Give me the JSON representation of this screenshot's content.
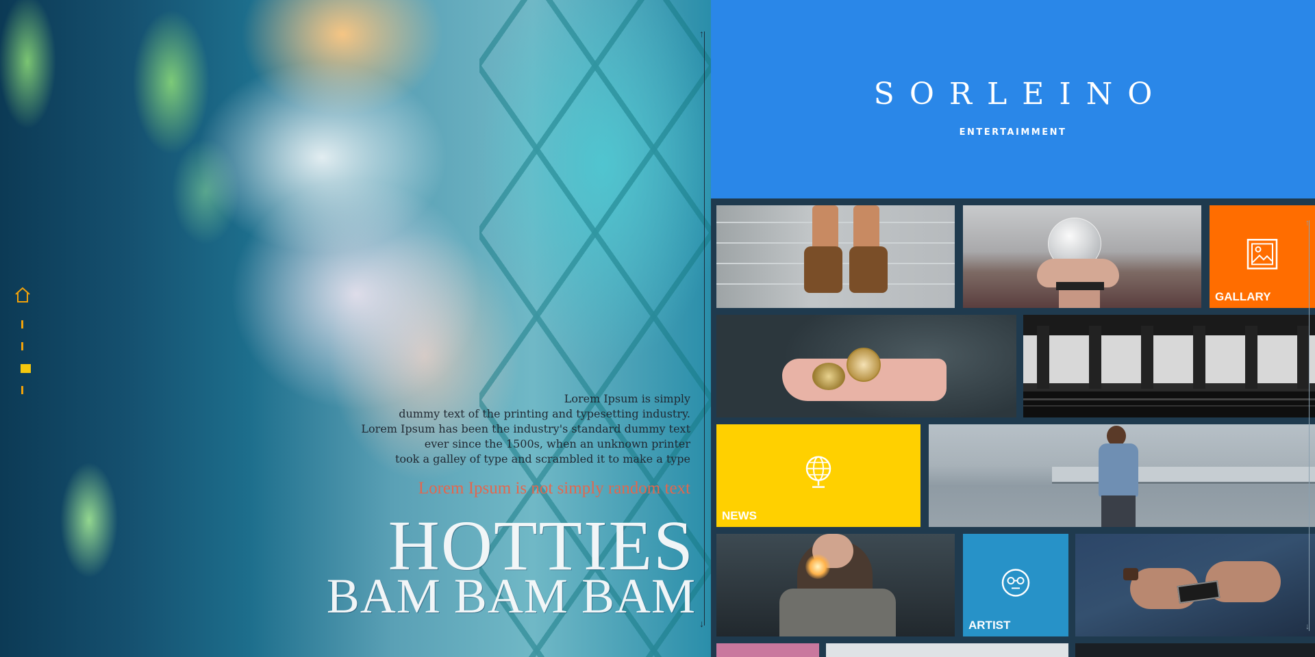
{
  "brand": {
    "name": "SORLEINO",
    "subtitle": "ENTERTAIMMENT",
    "color": "#2a87e8"
  },
  "nav": {
    "items": [
      "home-icon",
      "nav-dash",
      "nav-dash",
      "nav-active",
      "nav-dash"
    ],
    "accent": "#f2a20a",
    "active_color": "#f5c80e"
  },
  "hero": {
    "paragraph": [
      "Lorem Ipsum is simply",
      "dummy text of the printing and typesetting industry.",
      "Lorem Ipsum has been the industry's standard dummy text",
      "ever since the 1500s, when an unknown printer",
      "took a galley of type and scrambled it to make a type"
    ],
    "tagline": "Lorem Ipsum is not simply random text",
    "title": "HOTTIES",
    "subtitle": "BAM BAM BAM"
  },
  "tiles": {
    "gallery": {
      "label": "GALLARY",
      "color": "#ff6d00",
      "icon": "image-icon"
    },
    "news": {
      "label": "NEWS",
      "color": "#ffd000",
      "icon": "globe-icon"
    },
    "artist": {
      "label": "ARTIST",
      "color": "#2792c8",
      "icon": "face-icon"
    },
    "photos": [
      "boots-on-drawers-photo",
      "hand-holding-glass-ball-photo",
      "hand-holding-compass-photo",
      "subway-station-photo",
      "man-by-lake-photo",
      "woman-with-sparkler-photo",
      "hands-with-phone-photo"
    ]
  }
}
